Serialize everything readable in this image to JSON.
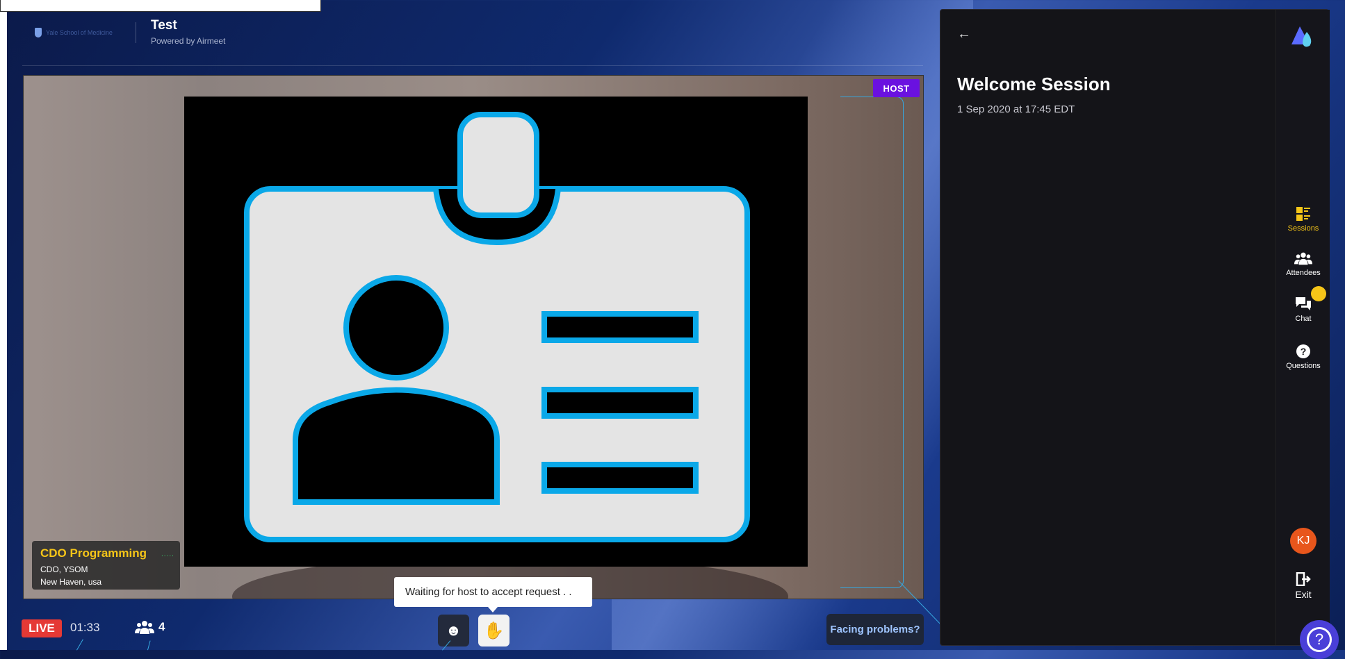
{
  "header": {
    "brand_text": "Yale School of Medicine",
    "event_title": "Test",
    "powered_by": "Powered by Airmeet"
  },
  "stage": {
    "host_badge": "HOST",
    "speaker": {
      "name": "CDO Programming",
      "title": "CDO, YSOM",
      "location": "New Haven, usa",
      "indicator": "....."
    }
  },
  "controls": {
    "live_label": "LIVE",
    "timer": "01:33",
    "attendee_count": "4",
    "emoji_icon": "☻",
    "hand_icon": "✋",
    "tooltip": "Waiting for host to accept request . .",
    "facing_problems": "Facing problems?"
  },
  "panel": {
    "back_icon": "←",
    "session_title": "Welcome Session",
    "session_date": "1 Sep 2020 at 17:45 EDT"
  },
  "rail": {
    "items": [
      {
        "label": "Sessions",
        "icon": "sessions-icon",
        "active": true
      },
      {
        "label": "Attendees",
        "icon": "attendees-icon",
        "active": false
      },
      {
        "label": "Chat",
        "icon": "chat-icon",
        "active": false
      },
      {
        "label": "Questions",
        "icon": "questions-icon",
        "active": false
      }
    ],
    "avatar_initials": "KJ",
    "exit_label": "Exit"
  },
  "help_icon": "?",
  "colors": {
    "accent_yellow": "#f5c518",
    "host_purple": "#6a11e0",
    "live_red": "#e53935",
    "line_blue": "#36a8e0",
    "panel_bg": "#141418"
  }
}
